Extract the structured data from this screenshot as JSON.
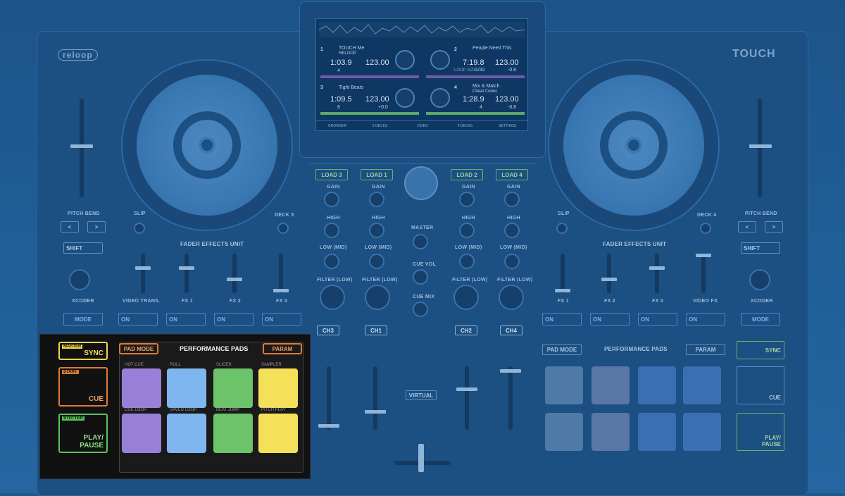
{
  "brand_left": "reloop",
  "brand_right": "TOUCH",
  "screen": {
    "deck1": {
      "num": "1",
      "title": "TOUCH Me",
      "artist": "RELOOP",
      "time": "1:03.9",
      "bpm": "123.00",
      "loop": "4"
    },
    "deck2": {
      "num": "2",
      "title": "People Need This",
      "time": "7:19.8",
      "bpm": "123.00",
      "loop_size_label": "LOOP SIZE",
      "loop": "1/32",
      "pitch": "-0.8"
    },
    "deck3": {
      "num": "3",
      "title": "Tight Beats",
      "time": "1:09.5",
      "bpm": "123.00",
      "loop": "8",
      "pitch": "+0.0"
    },
    "deck4": {
      "num": "4",
      "title": "Mix & Match",
      "artist": "Cheat Codes",
      "time": "1:28.9",
      "bpm": "123.00",
      "loop": "4",
      "pitch": "-0.8"
    },
    "tabs": [
      "BROWSER",
      "2 DECKS",
      "VIDEO",
      "4 DECKS",
      "SETTINGS"
    ]
  },
  "left": {
    "pitch_bend": "PITCH BEND",
    "shift": "SHIFT",
    "slip": "SLIP",
    "deck3": "DECK 3",
    "xcoder": "XCODER",
    "mode": "MODE",
    "fader_effects": "FADER EFFECTS UNIT",
    "fx_labels": [
      "VIDEO TRANS.",
      "FX 1",
      "FX 2",
      "FX 3"
    ],
    "on": "ON"
  },
  "right": {
    "pitch_bend": "PITCH BEND",
    "shift": "SHIFT",
    "slip": "SLIP",
    "deck4": "DECK 4",
    "xcoder": "XCODER",
    "mode": "MODE",
    "fader_effects": "FADER EFFECTS UNIT",
    "fx_labels": [
      "FX 1",
      "FX 2",
      "FX 3",
      "VIDEO FX"
    ],
    "on": "ON",
    "pad_mode": "PAD MODE",
    "performance_pads": "PERFORMANCE PADS",
    "param": "PARAM",
    "sync": "SYNC",
    "cue": "CUE",
    "play_pause": "PLAY/\nPAUSE"
  },
  "mixer": {
    "load": [
      "LOAD 3",
      "LOAD 1",
      "LOAD 2",
      "LOAD 4"
    ],
    "gain": "GAIN",
    "high": "HIGH",
    "low_mid": "LOW (MID)",
    "filter_low": "FILTER (LOW)",
    "master": "MASTER",
    "cue_vol": "CUE VOL",
    "cue_mix": "CUE MIX",
    "channels": [
      "CH3",
      "CH1",
      "CH2",
      "CH4"
    ],
    "virtual": "VIRTUAL"
  },
  "highlight": {
    "master": "MASTER",
    "sync": "SYNC",
    "start": "START",
    "cue": "CUE",
    "stutter": "STUTTER",
    "play_pause": "PLAY/\nPAUSE",
    "pad_mode": "PAD MODE",
    "performance_pads": "PERFORMANCE PADS",
    "param": "PARAM",
    "pad_labels_top": [
      "HOT CUE",
      "ROLL",
      "SLICER",
      "SAMPLER"
    ],
    "pad_labels_bottom": [
      "CUE LOOP",
      "SAVED LOOP",
      "BEAT JUMP",
      "PITCH PLAY"
    ],
    "colors": {
      "purple": "#9a7fd8",
      "blue": "#7fb6f0",
      "green": "#6cc36a",
      "yellow": "#f5e05a"
    }
  }
}
